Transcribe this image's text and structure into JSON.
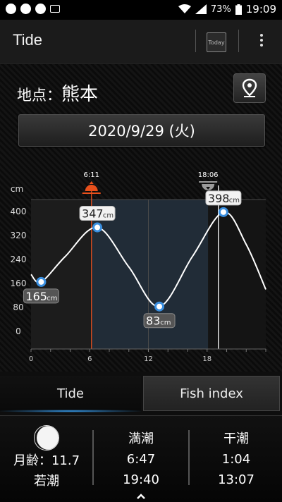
{
  "status_bar": {
    "battery": "73%",
    "time": "19:09",
    "icons": [
      "notification-icon",
      "sync-icon",
      "chat-icon",
      "image-icon",
      "wifi-icon",
      "signal-icon",
      "battery-icon"
    ]
  },
  "app_bar": {
    "title": "Tide",
    "today_label": "Today",
    "icons": [
      "today-icon",
      "overflow-menu-icon"
    ]
  },
  "location": {
    "label": "地点：",
    "name": "熊本",
    "icon": "location-pin-icon"
  },
  "date": "2020/9/29 (火)",
  "chart_data": {
    "type": "line",
    "ylabel": "cm",
    "x_ticks": [
      "0",
      "6",
      "12",
      "18"
    ],
    "y_ticks": [
      "0",
      "80",
      "160",
      "240",
      "320",
      "400"
    ],
    "xlim": [
      0,
      24
    ],
    "ylim": [
      0,
      400
    ],
    "series": [
      {
        "x": [
          0,
          1.04,
          3.5,
          6.78,
          10,
          13.12,
          16.5,
          19.67,
          22,
          24
        ],
        "values": [
          190,
          165,
          250,
          347,
          215,
          83,
          250,
          398,
          290,
          140
        ]
      }
    ],
    "markers": [
      {
        "x": 1.04,
        "y": 165,
        "label_value": "165",
        "unit": "cm"
      },
      {
        "x": 6.78,
        "y": 347,
        "label_value": "347",
        "unit": "cm"
      },
      {
        "x": 13.12,
        "y": 83,
        "label_value": "83",
        "unit": "cm"
      },
      {
        "x": 19.67,
        "y": 398,
        "label_value": "398",
        "unit": "cm"
      }
    ],
    "sunrise": {
      "x": 6.18,
      "label": "6:11",
      "icon": "sunrise-icon"
    },
    "sunset": {
      "x": 18.1,
      "label": "18:06",
      "icon": "sunset-icon"
    },
    "now_x": 19.15,
    "colors": {
      "sunrise": "#e8501c",
      "line": "#ffffff",
      "marker": "#3a8fe0"
    }
  },
  "tabs": {
    "tide": "Tide",
    "fish_index": "Fish index",
    "accent": "#3aa7ff"
  },
  "moon": {
    "age_label": "月齢：",
    "age_value": "11.7",
    "phase": "若潮",
    "icon": "moon-phase-icon"
  },
  "high_tide": {
    "label": "満潮",
    "times": [
      "6:47",
      "19:40"
    ]
  },
  "low_tide": {
    "label": "干潮",
    "times": [
      "1:04",
      "13:07"
    ]
  }
}
